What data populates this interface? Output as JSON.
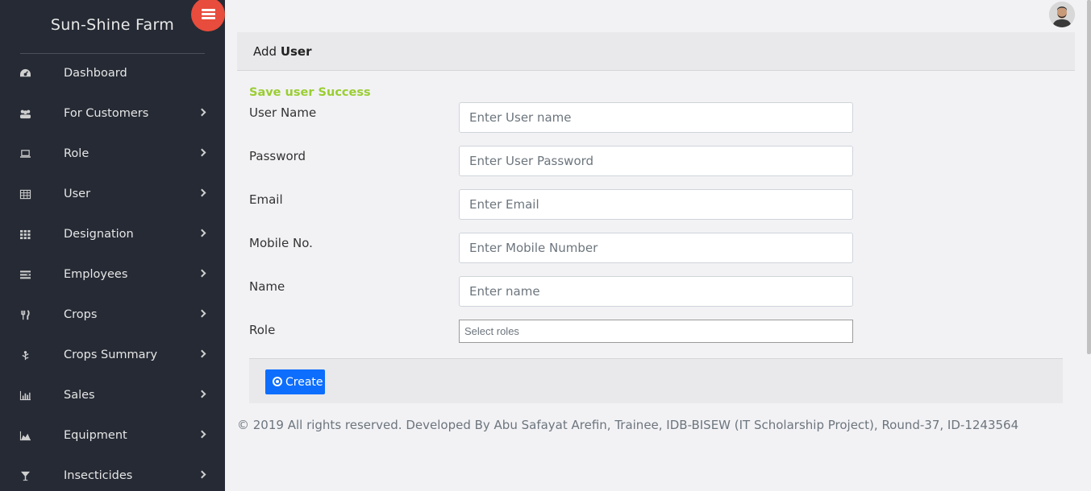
{
  "sidebar": {
    "brand": "Sun-Shine Farm",
    "toggle_icon": "menu-icon",
    "items": [
      {
        "label": "Dashboard",
        "icon": "dashboard-icon",
        "has_children": false
      },
      {
        "label": "For Customers",
        "icon": "users-icon",
        "has_children": true
      },
      {
        "label": "Role",
        "icon": "laptop-icon",
        "has_children": true
      },
      {
        "label": "User",
        "icon": "table-icon",
        "has_children": true
      },
      {
        "label": "Designation",
        "icon": "grid-icon",
        "has_children": true
      },
      {
        "label": "Employees",
        "icon": "list-icon",
        "has_children": true
      },
      {
        "label": "Crops",
        "icon": "cutlery-icon",
        "has_children": true
      },
      {
        "label": "Crops Summary",
        "icon": "leaf-icon",
        "has_children": true
      },
      {
        "label": "Sales",
        "icon": "bar-chart-icon",
        "has_children": true
      },
      {
        "label": "Equipment",
        "icon": "area-chart-icon",
        "has_children": true
      },
      {
        "label": "Insecticides",
        "icon": "glass-icon",
        "has_children": true
      }
    ]
  },
  "header": {
    "avatar": "user-avatar"
  },
  "card": {
    "title_prefix": "Add",
    "title_bold": "User",
    "success_message": "Save user Success",
    "fields": {
      "username": {
        "label": "User Name",
        "placeholder": "Enter User name"
      },
      "password": {
        "label": "Password",
        "placeholder": "Enter User Password"
      },
      "email": {
        "label": "Email",
        "placeholder": "Enter Email"
      },
      "mobile": {
        "label": "Mobile No.",
        "placeholder": "Enter Mobile Number"
      },
      "name": {
        "label": "Name",
        "placeholder": "Enter name"
      },
      "role": {
        "label": "Role",
        "placeholder": "Select roles"
      }
    },
    "create_label": "Create"
  },
  "footer": {
    "text": "© 2019 All rights reserved. Developed By Abu Safayat Arefin, Trainee, IDB-BISEW (IT Scholarship Project), Round-37, ID-1243564"
  },
  "colors": {
    "sidebar_bg": "#252a34",
    "accent_red": "#e74c3c",
    "primary": "#0d6efd",
    "success": "#9acd32"
  }
}
